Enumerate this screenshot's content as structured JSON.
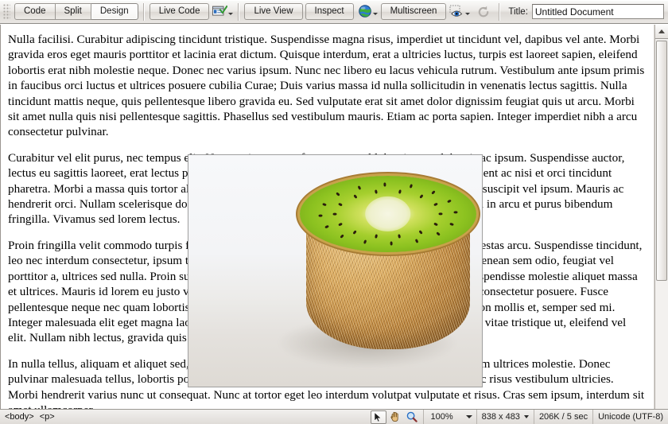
{
  "toolbar": {
    "view_modes": [
      {
        "label": "Code",
        "name": "view-mode-code",
        "active": false
      },
      {
        "label": "Split",
        "name": "view-mode-split",
        "active": false
      },
      {
        "label": "Design",
        "name": "view-mode-design",
        "active": true
      }
    ],
    "live_code_label": "Live Code",
    "inspect_validate_icon": "browser-check-icon",
    "live_view_label": "Live View",
    "inspect_label": "Inspect",
    "globe_icon": "globe-icon",
    "multiscreen_label": "Multiscreen",
    "visual_aids_icon": "eye-icon",
    "refresh_icon": "refresh-icon",
    "title_label": "Title:",
    "title_value": "Untitled Document",
    "title_placeholder": "Untitled Document"
  },
  "document": {
    "paragraphs": [
      "Nulla facilisi. Curabitur adipiscing tincidunt tristique. Suspendisse magna risus, imperdiet ut tincidunt vel, dapibus vel ante. Morbi gravida eros eget mauris porttitor et lacinia erat dictum. Quisque interdum, erat a ultricies luctus, turpis est laoreet sapien, eleifend lobortis erat nibh molestie neque. Donec nec varius ipsum. Nunc nec libero eu lacus vehicula rutrum. Vestibulum ante ipsum primis in faucibus orci luctus et ultrices posuere cubilia Curae; Duis varius massa id nulla sollicitudin in venenatis lectus sagittis. Nulla tincidunt mattis neque, quis pellentesque libero gravida eu. Sed vulputate erat sit amet dolor dignissim feugiat quis ut arcu. Morbi sit amet nulla quis nisi pellentesque sagittis. Phasellus sed vestibulum mauris. Etiam ac porta sapien. Integer imperdiet nibh a arcu consectetur pulvinar.",
      "Curabitur vel elit purus, nec tempus elit. Nam sapien augue, fermentum vel lobortis eget, lobortis ac ipsum. Suspendisse auctor, lectus eu sagittis laoreet, erat lectus pellentesque lorem, sed vestibulum risus ligula eu dolor. Praesent ac nisi et orci tincidunt pharetra. Morbi a massa quis tortor aliquam hendrerit. Morbi lacus nulla, auctor ut bibendum sed, suscipit vel ipsum. Mauris ac hendrerit orci. Nullam scelerisque dolor eget felis auctor quis tempor turpis condimentum. Nullam in arcu et purus bibendum fringilla. Vivamus sed lorem lectus.",
      "Proin fringilla velit commodo turpis fermentum a dapibus mauris vestibulum. In in elit dolor, a egestas arcu. Suspendisse tincidunt, leo nec interdum consectetur, ipsum tortor commodo lacus, non venenatis arcu turpis non dolor. Aenean sem odio, feugiat vel porttitor a, ultrices sed nulla. Proin suscipit pellentesque est, eu tristique sapien imperdiet non. Suspendisse molestie aliquet massa et ultrices. Mauris id lorem eu justo vulputate pulvinar ac at magna. Suspendisse et lorem eu erat consectetur posuere. Fusce pellentesque neque nec quam lobortis sed sodales magna pharetra. Aliquam lacus eros, pulvinar non mollis et, semper sed mi. Integer malesuada elit eget magna laoreet eu hendrerit velit convallis. Aliquam eros ipsum, iaculis vitae tristique ut, eleifend vel elit. Nullam nibh lectus, gravida quis luctus eu, cursus nec nisi.",
      "In nulla tellus, aliquam et aliquet sed, sagittis id ante. Integer pharetra aliquet nibh, vel aliquam sem ultrices molestie. Donec pulvinar malesuada tellus, lobortis porttitor eros lacinia nec. Sed at massa erat. Mauris non nisi nec risus vestibulum ultricies. Morbi hendrerit varius nunc ut consequat. Nunc at tortor eget leo interdum volutpat vulputate et risus. Cras sem ipsum, interdum sit amet ullamcorper"
    ],
    "image": {
      "name": "kiwi-fruit-photo",
      "alt": "Half a kiwi fruit on a white background"
    }
  },
  "statusbar": {
    "tag_selector": [
      "<body>",
      "<p>"
    ],
    "tools": [
      {
        "name": "select-tool",
        "icon": "cursor-arrow-icon",
        "selected": true
      },
      {
        "name": "hand-tool",
        "icon": "hand-icon",
        "selected": false
      },
      {
        "name": "zoom-tool",
        "icon": "magnifier-icon",
        "selected": false
      }
    ],
    "zoom_value": "100%",
    "window_size": "838 x 483",
    "doc_size": "206K / 5 sec",
    "encoding": "Unicode (UTF-8)"
  },
  "colors": {
    "chrome": "#e9e6e3",
    "chrome_border": "#9b9893",
    "canvas": "#ffffff",
    "text": "#000000",
    "kiwi_green": "#8cc220",
    "kiwi_skin": "#b9823c"
  }
}
